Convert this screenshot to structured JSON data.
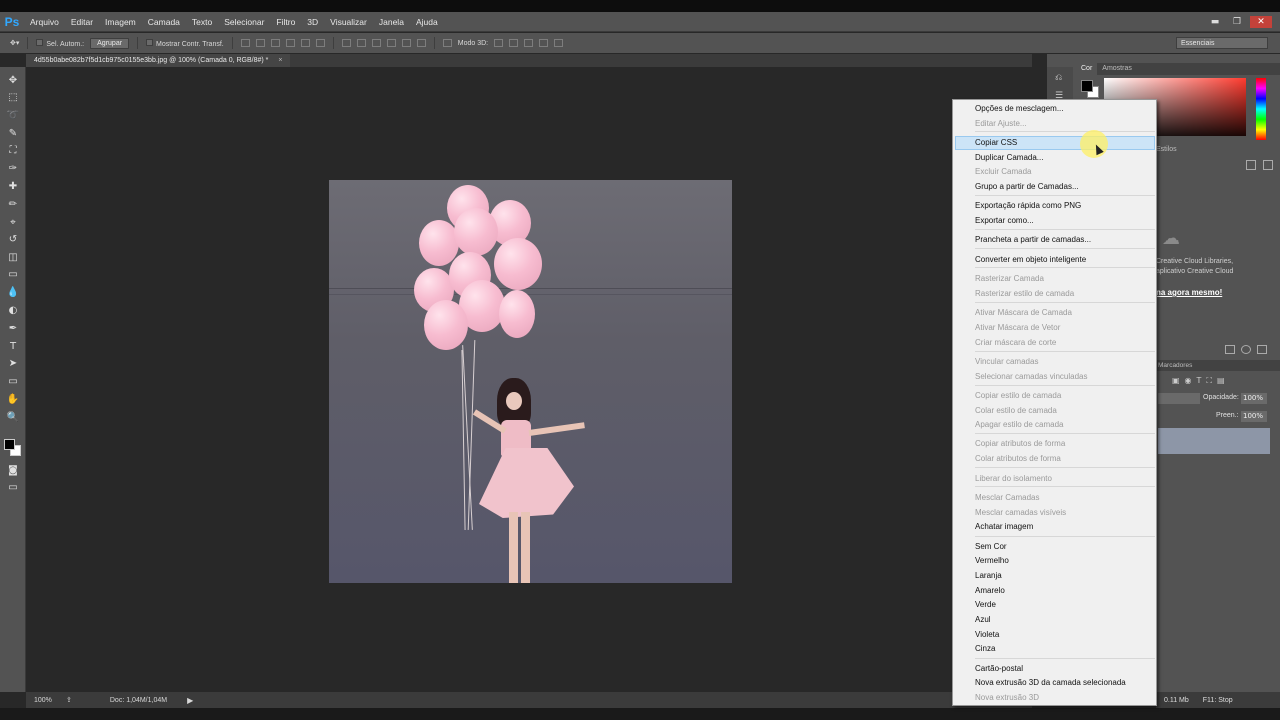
{
  "app": {
    "logo": "Ps"
  },
  "menubar": {
    "items": [
      "Arquivo",
      "Editar",
      "Imagem",
      "Camada",
      "Texto",
      "Selecionar",
      "Filtro",
      "3D",
      "Visualizar",
      "Janela",
      "Ajuda"
    ],
    "window_buttons": {
      "minimize": "▬",
      "restore": "❐",
      "close": "✕"
    }
  },
  "options": {
    "auto_select": "Sel. Autom.:",
    "group_select": "Agrupar",
    "transform_controls": "Mostrar Contr. Transf.",
    "mode_3d": "Modo 3D:",
    "workspace": "Essenciais"
  },
  "document": {
    "tab_title": "4d55b0abe082b7f5d1cb975c0155e3bb.jpg @ 100% (Camada 0, RGB/8#) *",
    "close": "×"
  },
  "tools": [
    "move-tool-icon",
    "marquee-tool-icon",
    "lasso-tool-icon",
    "quick-select-tool-icon",
    "crop-tool-icon",
    "eyedropper-tool-icon",
    "healing-brush-tool-icon",
    "brush-tool-icon",
    "clone-stamp-tool-icon",
    "history-brush-tool-icon",
    "eraser-tool-icon",
    "gradient-tool-icon",
    "blur-tool-icon",
    "dodge-tool-icon",
    "pen-tool-icon",
    "type-tool-icon",
    "path-select-tool-icon",
    "shape-tool-icon",
    "hand-tool-icon",
    "zoom-tool-icon"
  ],
  "tool_glyphs": [
    "✥",
    "⬚",
    "➰",
    "✎",
    "⛶",
    "✑",
    "✚",
    "✏",
    "⌖",
    "↺",
    "◫",
    "▭",
    "💧",
    "◐",
    "✒",
    "T",
    "➤",
    "▭",
    "✋",
    "🔍"
  ],
  "panels": {
    "color_tabs": [
      "Cor",
      "Amostras"
    ],
    "styles_tab": "Estilos",
    "cc_line1": "Creative Cloud Libraries,",
    "cc_line2": "aplicativo Creative Cloud",
    "cc_link": "na agora mesmo!",
    "layers_tab": "Marcadores",
    "opacity_label": "Opacidade:",
    "opacity_value": "100%",
    "fill_label": "Preen.:",
    "fill_value": "100%"
  },
  "status": {
    "zoom": "100%",
    "doc": "Doc: 1,04M/1,04M",
    "arrow": "▶",
    "memory": "0.11 Mb",
    "stop": "F11: Stop"
  },
  "context_menu": {
    "items": [
      {
        "label": "Opções de mesclagem...",
        "enabled": true
      },
      {
        "label": "Editar Ajuste...",
        "enabled": false
      },
      {
        "label": "Copiar CSS",
        "enabled": true,
        "highlighted": true
      },
      {
        "label": "Duplicar Camada...",
        "enabled": true
      },
      {
        "label": "Excluir Camada",
        "enabled": false
      },
      {
        "label": "Grupo a partir de Camadas...",
        "enabled": true
      },
      {
        "label": "Exportação rápida como PNG",
        "enabled": true
      },
      {
        "label": "Exportar como...",
        "enabled": true
      },
      {
        "label": "Prancheta a partir de camadas...",
        "enabled": true
      },
      {
        "label": "Converter em objeto inteligente",
        "enabled": true
      },
      {
        "label": "Rasterizar Camada",
        "enabled": false
      },
      {
        "label": "Rasterizar estilo de camada",
        "enabled": false
      },
      {
        "label": "Ativar Máscara de Camada",
        "enabled": false
      },
      {
        "label": "Ativar Máscara de Vetor",
        "enabled": false
      },
      {
        "label": "Criar máscara de corte",
        "enabled": false
      },
      {
        "label": "Vincular camadas",
        "enabled": false
      },
      {
        "label": "Selecionar camadas vinculadas",
        "enabled": false
      },
      {
        "label": "Copiar estilo de camada",
        "enabled": false
      },
      {
        "label": "Colar estilo de camada",
        "enabled": false
      },
      {
        "label": "Apagar estilo de camada",
        "enabled": false
      },
      {
        "label": "Copiar atributos de forma",
        "enabled": false
      },
      {
        "label": "Colar atributos de forma",
        "enabled": false
      },
      {
        "label": "Liberar do isolamento",
        "enabled": false
      },
      {
        "label": "Mesclar Camadas",
        "enabled": false
      },
      {
        "label": "Mesclar camadas visíveis",
        "enabled": false
      },
      {
        "label": "Achatar imagem",
        "enabled": true
      },
      {
        "label": "Sem Cor",
        "enabled": true
      },
      {
        "label": "Vermelho",
        "enabled": true
      },
      {
        "label": "Laranja",
        "enabled": true
      },
      {
        "label": "Amarelo",
        "enabled": true
      },
      {
        "label": "Verde",
        "enabled": true
      },
      {
        "label": "Azul",
        "enabled": true
      },
      {
        "label": "Violeta",
        "enabled": true
      },
      {
        "label": "Cinza",
        "enabled": true
      },
      {
        "label": "Cartão-postal",
        "enabled": true
      },
      {
        "label": "Nova extrusão 3D da camada selecionada",
        "enabled": true
      },
      {
        "label": "Nova extrusão 3D",
        "enabled": false
      }
    ]
  },
  "colors": {
    "ui_dark": "#535353",
    "canvas_bg": "#282828",
    "menu_highlight": "#cce4f7",
    "ps_blue": "#31a8ff",
    "close_red": "#c4423a"
  }
}
